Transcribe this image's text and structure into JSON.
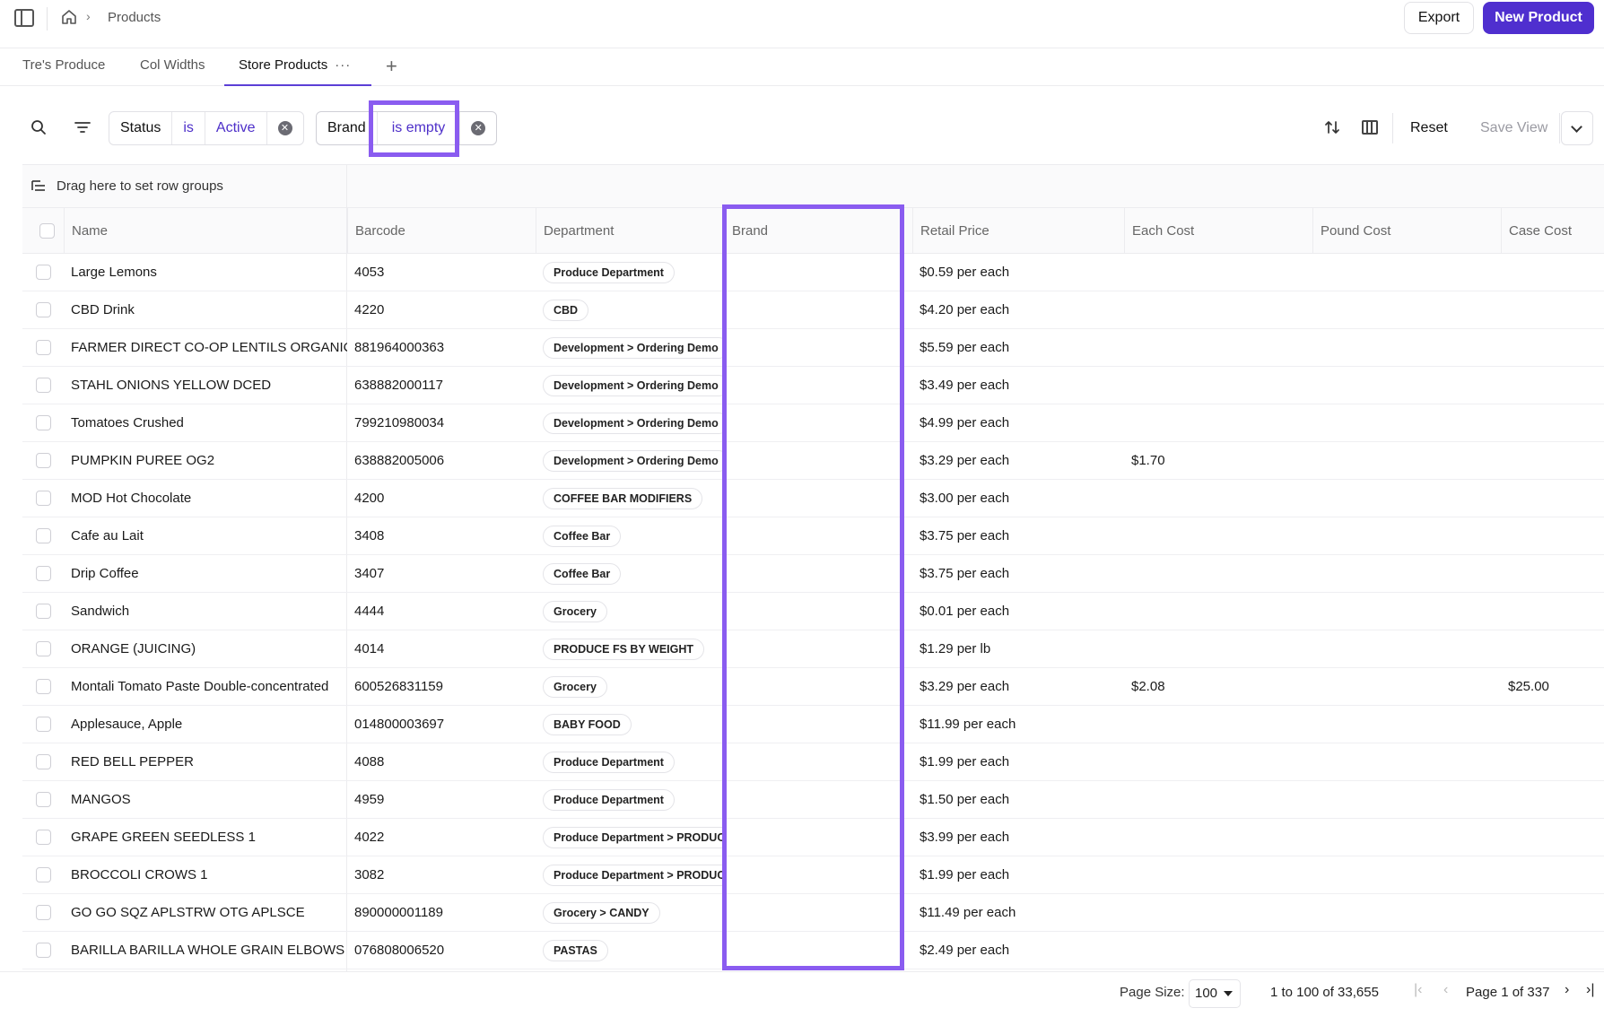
{
  "breadcrumb": {
    "current": "Products"
  },
  "actions": {
    "export_label": "Export",
    "new_label": "New Product"
  },
  "tabs": [
    {
      "label": "Tre's Produce",
      "active": false
    },
    {
      "label": "Col Widths",
      "active": false
    },
    {
      "label": "Store Products",
      "active": true,
      "menu": "···"
    }
  ],
  "tab_add": "+",
  "filters": [
    {
      "field": "Status",
      "operator": "is",
      "value": "Active"
    },
    {
      "field": "Brand",
      "operator": "is empty",
      "value": ""
    }
  ],
  "toolbar": {
    "reset_label": "Reset",
    "save_view_label": "Save View"
  },
  "row_groups": {
    "placeholder": "Drag here to set row groups"
  },
  "columns": [
    "Name",
    "Barcode",
    "Department",
    "Brand",
    "Retail Price",
    "Each Cost",
    "Pound Cost",
    "Case Cost"
  ],
  "rows": [
    {
      "name": "Large Lemons",
      "barcode": "4053",
      "department": "Produce Department",
      "brand": "",
      "retail": "$0.59 per each",
      "each": "",
      "pound": "",
      "case": ""
    },
    {
      "name": "CBD Drink",
      "barcode": "4220",
      "department": "CBD",
      "brand": "",
      "retail": "$4.20 per each",
      "each": "",
      "pound": "",
      "case": ""
    },
    {
      "name": "FARMER DIRECT CO-OP LENTILS ORGANIC FRENCH GREEN",
      "barcode": "881964000363",
      "department": "Development > Ordering Demo",
      "brand": "",
      "retail": "$5.59 per each",
      "each": "",
      "pound": "",
      "case": ""
    },
    {
      "name": "STAHL ONIONS YELLOW DCED",
      "barcode": "638882000117",
      "department": "Development > Ordering Demo",
      "brand": "",
      "retail": "$3.49 per each",
      "each": "",
      "pound": "",
      "case": ""
    },
    {
      "name": "Tomatoes Crushed",
      "barcode": "799210980034",
      "department": "Development > Ordering Demo",
      "brand": "",
      "retail": "$4.99 per each",
      "each": "",
      "pound": "",
      "case": ""
    },
    {
      "name": "PUMPKIN PUREE OG2",
      "barcode": "638882005006",
      "department": "Development > Ordering Demo",
      "brand": "",
      "retail": "$3.29 per each",
      "each": "$1.70",
      "pound": "",
      "case": ""
    },
    {
      "name": "MOD Hot Chocolate",
      "barcode": "4200",
      "department": "COFFEE BAR MODIFIERS",
      "brand": "",
      "retail": "$3.00 per each",
      "each": "",
      "pound": "",
      "case": ""
    },
    {
      "name": "Cafe au Lait",
      "barcode": "3408",
      "department": "Coffee Bar",
      "brand": "",
      "retail": "$3.75 per each",
      "each": "",
      "pound": "",
      "case": ""
    },
    {
      "name": "Drip Coffee",
      "barcode": "3407",
      "department": "Coffee Bar",
      "brand": "",
      "retail": "$3.75 per each",
      "each": "",
      "pound": "",
      "case": ""
    },
    {
      "name": "Sandwich",
      "barcode": "4444",
      "department": "Grocery",
      "brand": "",
      "retail": "$0.01 per each",
      "each": "",
      "pound": "",
      "case": ""
    },
    {
      "name": "ORANGE (JUICING)",
      "barcode": "4014",
      "department": "PRODUCE FS BY WEIGHT",
      "brand": "",
      "retail": "$1.29 per lb",
      "each": "",
      "pound": "",
      "case": ""
    },
    {
      "name": "Montali Tomato Paste Double-concentrated",
      "barcode": "600526831159",
      "department": "Grocery",
      "brand": "",
      "retail": "$3.29 per each",
      "each": "$2.08",
      "pound": "",
      "case": "$25.00"
    },
    {
      "name": "Applesauce, Apple",
      "barcode": "014800003697",
      "department": "BABY FOOD",
      "brand": "",
      "retail": "$11.99 per each",
      "each": "",
      "pound": "",
      "case": ""
    },
    {
      "name": "RED BELL PEPPER",
      "barcode": "4088",
      "department": "Produce Department",
      "brand": "",
      "retail": "$1.99 per each",
      "each": "",
      "pound": "",
      "case": ""
    },
    {
      "name": "MANGOS",
      "barcode": "4959",
      "department": "Produce Department",
      "brand": "",
      "retail": "$1.50 per each",
      "each": "",
      "pound": "",
      "case": ""
    },
    {
      "name": "GRAPE GREEN SEEDLESS 1",
      "barcode": "4022",
      "department": "Produce Department > PRODUCE",
      "brand": "",
      "retail": "$3.99 per each",
      "each": "",
      "pound": "",
      "case": ""
    },
    {
      "name": "BROCCOLI CROWS 1",
      "barcode": "3082",
      "department": "Produce Department > PRODUCE",
      "brand": "",
      "retail": "$1.99 per each",
      "each": "",
      "pound": "",
      "case": ""
    },
    {
      "name": "GO GO SQZ APLSTRW OTG APLSCE",
      "barcode": "890000001189",
      "department": "Grocery > CANDY",
      "brand": "",
      "retail": "$11.49 per each",
      "each": "",
      "pound": "",
      "case": ""
    },
    {
      "name": "BARILLA BARILLA WHOLE GRAIN ELBOWS",
      "barcode": "076808006520",
      "department": "PASTAS",
      "brand": "",
      "retail": "$2.49 per each",
      "each": "",
      "pound": "",
      "case": ""
    }
  ],
  "pagination": {
    "page_size_label": "Page Size:",
    "page_size": "100",
    "range": "1 to 100 of 33,655",
    "page": "Page 1 of 337"
  },
  "icons": {
    "first": "|‹",
    "prev": "‹",
    "next": "›",
    "last": "›|",
    "sort": "sort-icon",
    "columns": "columns-icon",
    "search": "search-icon",
    "filter": "filter-icon"
  },
  "colors": {
    "accent": "#4f2fcf",
    "highlight": "#8a5cf0"
  }
}
